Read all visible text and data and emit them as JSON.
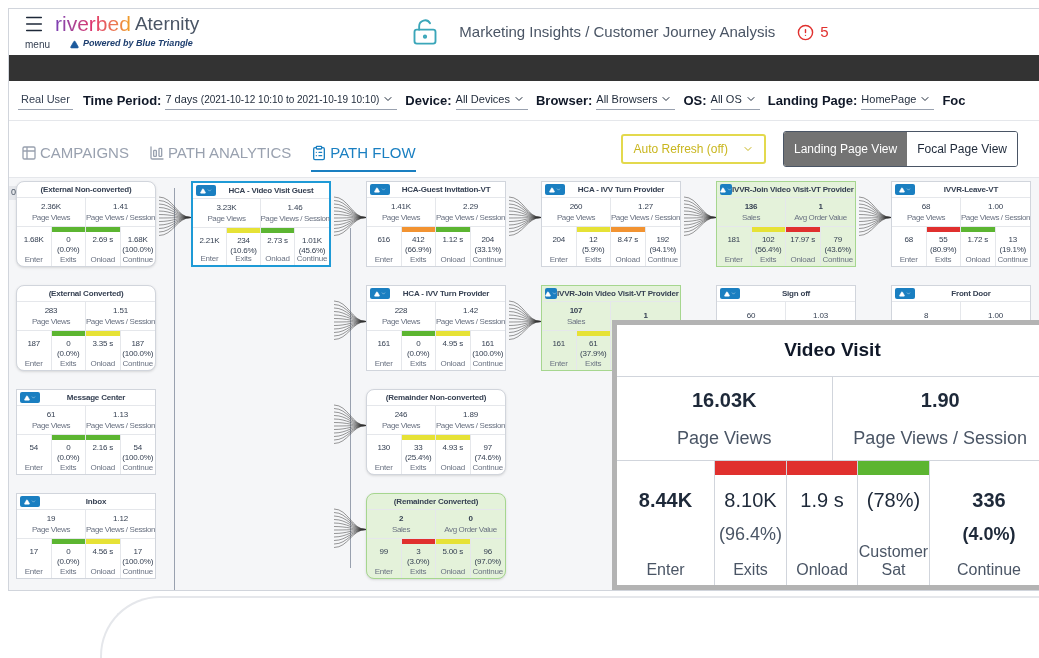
{
  "header": {
    "menu_label": "menu",
    "brand": "riverbed",
    "product": "Aternity",
    "tagline": "Powered by Blue Triangle",
    "breadcrumb": "Marketing Insights / Customer Journey Analysis",
    "alert_count": "5"
  },
  "filters": {
    "user_type": "Real User",
    "items": [
      {
        "label": "Time Period:",
        "value": "7 days",
        "detail": "(2021-10-12 10:10 to 2021-10-19 10:10)"
      },
      {
        "label": "Device:",
        "value": "All Devices"
      },
      {
        "label": "Browser:",
        "value": "All Browsers"
      },
      {
        "label": "OS:",
        "value": "All OS"
      },
      {
        "label": "Landing Page:",
        "value": "HomePage"
      },
      {
        "label": "Foc"
      }
    ]
  },
  "tabs": [
    {
      "label": "CAMPAIGNS",
      "selected": false
    },
    {
      "label": "PATH ANALYTICS",
      "selected": false
    },
    {
      "label": "PATH FLOW",
      "selected": true
    }
  ],
  "auto_refresh": "Auto Refresh (off)",
  "views": [
    {
      "label": "Landing Page View",
      "selected": true
    },
    {
      "label": "Focal Page View",
      "selected": false
    }
  ],
  "canvas_badge": "0",
  "columns": [
    [
      {
        "title": "(External Non-converted)",
        "menu": false,
        "kind": "plain",
        "metrics": [
          {
            "value": "2.36K",
            "label": "Page Views"
          },
          {
            "value": "1.41",
            "label": "Page Views / Session"
          }
        ],
        "cells": [
          {
            "value": "1.68K",
            "label": "Enter"
          },
          {
            "value": "0",
            "pct": "(0.0%)",
            "label": "Exits",
            "color": "#5cb531"
          },
          {
            "value": "2.69 s",
            "label": "Onload",
            "color": "#5cb531"
          },
          {
            "value": "1.68K",
            "pct": "(100.0%)",
            "label": "Continue"
          }
        ]
      },
      {
        "title": "(External Converted)",
        "menu": false,
        "kind": "plain",
        "metrics": [
          {
            "value": "283",
            "label": "Page Views"
          },
          {
            "value": "1.51",
            "label": "Page Views / Session"
          }
        ],
        "cells": [
          {
            "value": "187",
            "label": "Enter"
          },
          {
            "value": "0",
            "pct": "(0.0%)",
            "label": "Exits",
            "color": "#5cb531"
          },
          {
            "value": "3.35 s",
            "label": "Onload",
            "color": "#e6e236"
          },
          {
            "value": "187",
            "pct": "(100.0%)",
            "label": "Continue"
          }
        ]
      },
      {
        "title": "Message Center",
        "menu": true,
        "kind": "plain",
        "metrics": [
          {
            "value": "61",
            "label": "Page Views"
          },
          {
            "value": "1.13",
            "label": "Page Views / Session"
          }
        ],
        "cells": [
          {
            "value": "54",
            "label": "Enter"
          },
          {
            "value": "0",
            "pct": "(0.0%)",
            "label": "Exits",
            "color": "#5cb531"
          },
          {
            "value": "2.16 s",
            "label": "Onload",
            "color": "#5cb531"
          },
          {
            "value": "54",
            "pct": "(100.0%)",
            "label": "Continue"
          }
        ]
      },
      {
        "title": "Inbox",
        "menu": true,
        "kind": "plain",
        "metrics": [
          {
            "value": "19",
            "label": "Page Views"
          },
          {
            "value": "1.12",
            "label": "Page Views / Session"
          }
        ],
        "cells": [
          {
            "value": "17",
            "label": "Enter"
          },
          {
            "value": "0",
            "pct": "(0.0%)",
            "label": "Exits",
            "color": "#5cb531"
          },
          {
            "value": "4.56 s",
            "label": "Onload",
            "color": "#e6e236"
          },
          {
            "value": "17",
            "pct": "(100.0%)",
            "label": "Continue"
          }
        ]
      }
    ],
    [
      {
        "title": "HCA - Video Visit Guest",
        "menu": true,
        "kind": "selected",
        "metrics": [
          {
            "value": "3.23K",
            "label": "Page Views"
          },
          {
            "value": "1.46",
            "label": "Page Views / Session"
          }
        ],
        "cells": [
          {
            "value": "2.21K",
            "label": "Enter"
          },
          {
            "value": "234",
            "pct": "(10.6%)",
            "label": "Exits",
            "color": "#e6e236"
          },
          {
            "value": "2.73 s",
            "label": "Onload",
            "color": "#5cb531"
          },
          {
            "value": "1.01K",
            "pct": "(45.6%)",
            "label": "Continue"
          }
        ]
      }
    ],
    [
      {
        "title": "HCA-Guest Invitation-VT",
        "menu": true,
        "kind": "plain",
        "metrics": [
          {
            "value": "1.41K",
            "label": "Page Views"
          },
          {
            "value": "2.29",
            "label": "Page Views / Session"
          }
        ],
        "cells": [
          {
            "value": "616",
            "label": "Enter"
          },
          {
            "value": "412",
            "pct": "(66.9%)",
            "label": "Exits",
            "color": "#f29331"
          },
          {
            "value": "1.12 s",
            "label": "Onload",
            "color": "#5cb531"
          },
          {
            "value": "204",
            "pct": "(33.1%)",
            "label": "Continue"
          }
        ]
      },
      {
        "title": "HCA - IVV Turn Provider",
        "menu": true,
        "kind": "plain",
        "metrics": [
          {
            "value": "228",
            "label": "Page Views"
          },
          {
            "value": "1.42",
            "label": "Page Views / Session"
          }
        ],
        "cells": [
          {
            "value": "161",
            "label": "Enter"
          },
          {
            "value": "0",
            "pct": "(0.0%)",
            "label": "Exits",
            "color": "#5cb531"
          },
          {
            "value": "4.95 s",
            "label": "Onload",
            "color": "#e6e236"
          },
          {
            "value": "161",
            "pct": "(100.0%)",
            "label": "Continue"
          }
        ]
      },
      {
        "title": "(Remainder Non-converted)",
        "menu": false,
        "kind": "plain",
        "metrics": [
          {
            "value": "246",
            "label": "Page Views"
          },
          {
            "value": "1.89",
            "label": "Page Views / Session"
          }
        ],
        "cells": [
          {
            "value": "130",
            "label": "Enter"
          },
          {
            "value": "33",
            "pct": "(25.4%)",
            "label": "Exits",
            "color": "#e6e236"
          },
          {
            "value": "4.93 s",
            "label": "Onload",
            "color": "#e6e236"
          },
          {
            "value": "97",
            "pct": "(74.6%)",
            "label": "Continue"
          }
        ]
      },
      {
        "title": "(Remainder Converted)",
        "menu": false,
        "kind": "converted",
        "metrics": [
          {
            "value": "2",
            "label": "Sales"
          },
          {
            "value": "0",
            "label": "Avg Order Value"
          }
        ],
        "cells": [
          {
            "value": "99",
            "label": "Enter"
          },
          {
            "value": "3",
            "pct": "(3.0%)",
            "label": "Exits",
            "color": "#e0302e"
          },
          {
            "value": "5.00 s",
            "label": "Onload",
            "color": "#e6e236"
          },
          {
            "value": "96",
            "pct": "(97.0%)",
            "label": "Continue"
          }
        ]
      }
    ],
    [
      {
        "title": "HCA - IVV Turn Provider",
        "menu": true,
        "kind": "plain",
        "metrics": [
          {
            "value": "260",
            "label": "Page Views"
          },
          {
            "value": "1.27",
            "label": "Page Views / Session"
          }
        ],
        "cells": [
          {
            "value": "204",
            "label": "Enter"
          },
          {
            "value": "12",
            "pct": "(5.9%)",
            "label": "Exits",
            "color": "#e6e236"
          },
          {
            "value": "8.47 s",
            "label": "Onload",
            "color": "#f29331"
          },
          {
            "value": "192",
            "pct": "(94.1%)",
            "label": "Continue"
          }
        ]
      },
      {
        "title": "IVVR-Join Video Visit-VT Provider",
        "menu": true,
        "kind": "converted",
        "metrics": [
          {
            "value": "107",
            "label": "Sales"
          },
          {
            "value": "1"
          }
        ],
        "cells": [
          {
            "value": "161",
            "label": "Enter"
          },
          {
            "value": "61",
            "pct": "(37.9%)",
            "label": "Exits",
            "color": "#e6e236"
          }
        ]
      }
    ],
    [
      {
        "title": "IVVR-Join Video Visit-VT Provider",
        "menu": true,
        "kind": "converted",
        "metrics": [
          {
            "value": "136",
            "label": "Sales"
          },
          {
            "value": "1",
            "label": "Avg Order Value"
          }
        ],
        "cells": [
          {
            "value": "181",
            "label": "Enter"
          },
          {
            "value": "102",
            "pct": "(56.4%)",
            "label": "Exits",
            "color": "#e6e236"
          },
          {
            "value": "17.97 s",
            "label": "Onload",
            "color": "#e0302e"
          },
          {
            "value": "79",
            "pct": "(43.6%)",
            "label": "Continue"
          }
        ]
      },
      {
        "title": "Sign off",
        "menu": true,
        "kind": "plain",
        "metrics": [
          {
            "value": "60"
          },
          {
            "value": "1.03"
          }
        ]
      }
    ],
    [
      {
        "title": "IVVR-Leave-VT",
        "menu": true,
        "kind": "plain",
        "metrics": [
          {
            "value": "68",
            "label": "Page Views"
          },
          {
            "value": "1.00",
            "label": "Page Views / Session"
          }
        ],
        "cells": [
          {
            "value": "68",
            "label": "Enter"
          },
          {
            "value": "55",
            "pct": "(80.9%)",
            "label": "Exits",
            "color": "#e0302e"
          },
          {
            "value": "1.72 s",
            "label": "Onload",
            "color": "#5cb531"
          },
          {
            "value": "13",
            "pct": "(19.1%)",
            "label": "Continue"
          }
        ]
      },
      {
        "title": "Front Door",
        "menu": true,
        "kind": "plain",
        "metrics": [
          {
            "value": "8"
          },
          {
            "value": "1.00"
          }
        ]
      }
    ]
  ],
  "detail": {
    "title": "Video Visit",
    "metrics": [
      {
        "value": "16.03K",
        "label": "Page Views"
      },
      {
        "value": "1.90",
        "label": "Page Views / Session"
      }
    ],
    "cells": [
      {
        "value": "8.44K",
        "label": "Enter",
        "bold": true
      },
      {
        "value": "8.10K",
        "pct": "(96.4%)",
        "label": "Exits",
        "color": "#e0302e",
        "bold": false
      },
      {
        "value": "1.9 s",
        "label": "Onload",
        "color": "#e0302e",
        "bold": false
      },
      {
        "value": "(78%)",
        "label": "Customer Sat",
        "color": "#5cb531",
        "bold": false
      },
      {
        "value": "336",
        "pct": "(4.0%)",
        "label": "Continue",
        "bold": true
      }
    ]
  }
}
